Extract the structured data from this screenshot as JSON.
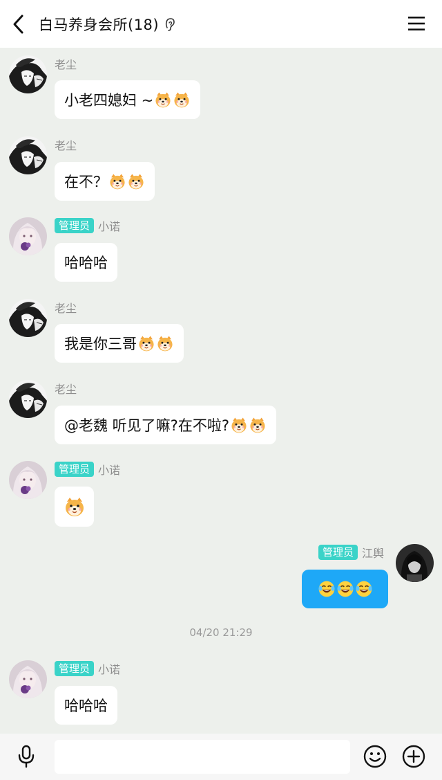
{
  "header": {
    "title": "白马养身会所(18)",
    "back_icon": "chevron-left-icon",
    "ear_icon": "ear-icon",
    "menu_icon": "hamburger-menu-icon"
  },
  "messages": [
    {
      "sender": "老尘",
      "badge": "",
      "text": "小老四媳妇 ~ ",
      "emoji_count": 2
    },
    {
      "sender": "老尘",
      "badge": "",
      "text": "在不？ ",
      "emoji_count": 2
    },
    {
      "sender": "小诺",
      "badge": "管理员",
      "text": "哈哈哈",
      "emoji_count": 0
    },
    {
      "sender": "老尘",
      "badge": "",
      "text": "我是你三哥",
      "emoji_count": 2
    },
    {
      "sender": "老尘",
      "badge": "",
      "text": "@老魏 听见了嘛?在不啦?",
      "emoji_count": 2
    },
    {
      "sender": "小诺",
      "badge": "管理员",
      "text": "",
      "emoji_count": 1
    },
    {
      "sender": "江舆",
      "badge": "管理员",
      "text": "",
      "emoji_count": 3,
      "outgoing": true
    },
    {
      "sender": "小诺",
      "badge": "管理员",
      "text": "哈哈哈",
      "emoji_count": 0
    }
  ],
  "timestamp": "04/20 21:29",
  "composer": {
    "placeholder": "",
    "mic_icon": "microphone-icon",
    "emoji_icon": "smiley-icon",
    "plus_icon": "plus-circle-icon"
  },
  "colors": {
    "background": "#edf0ec",
    "badge": "#3ad3c8",
    "outgoing_bubble": "#1ea8f7"
  }
}
